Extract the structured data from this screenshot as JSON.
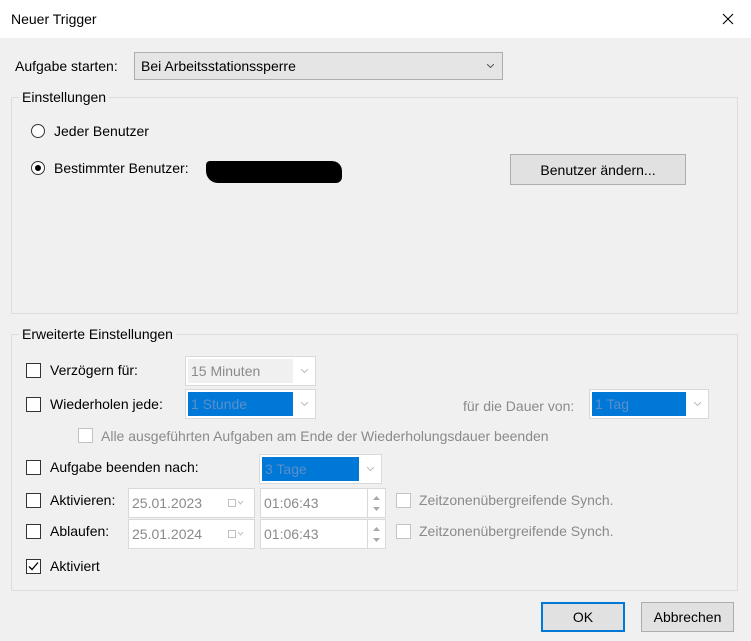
{
  "window": {
    "title": "Neuer Trigger"
  },
  "start": {
    "label": "Aufgabe starten:",
    "value": "Bei Arbeitsstationssperre"
  },
  "settings": {
    "title": "Einstellungen",
    "radio_all_users": "Jeder Benutzer",
    "radio_specific_user": "Bestimmter Benutzer:",
    "selected_radio": "specific_user",
    "change_user_button": "Benutzer ändern..."
  },
  "advanced": {
    "title": "Erweiterte Einstellungen",
    "delay": {
      "label": "Verzögern für:",
      "checked": false,
      "value": "15 Minuten"
    },
    "repeat": {
      "label": "Wiederholen jede:",
      "checked": false,
      "value": "1 Stunde",
      "duration_label": "für die Dauer von:",
      "duration_value": "1 Tag"
    },
    "stop_all": {
      "label": "Alle ausgeführten Aufgaben am Ende der Wiederholungsdauer beenden",
      "checked": false
    },
    "stop_after": {
      "label": "Aufgabe beenden nach:",
      "checked": false,
      "value": "3 Tage"
    },
    "activate": {
      "label": "Aktivieren:",
      "checked": false,
      "date": "25.01.2023",
      "time": "01:06:43",
      "sync_label": "Zeitzonenübergreifende Synch."
    },
    "expire": {
      "label": "Ablaufen:",
      "checked": false,
      "date": "25.01.2024",
      "time": "01:06:43",
      "sync_label": "Zeitzonenübergreifende Synch."
    },
    "enabled": {
      "label": "Aktiviert",
      "checked": true
    }
  },
  "buttons": {
    "ok": "OK",
    "cancel": "Abbrechen"
  }
}
